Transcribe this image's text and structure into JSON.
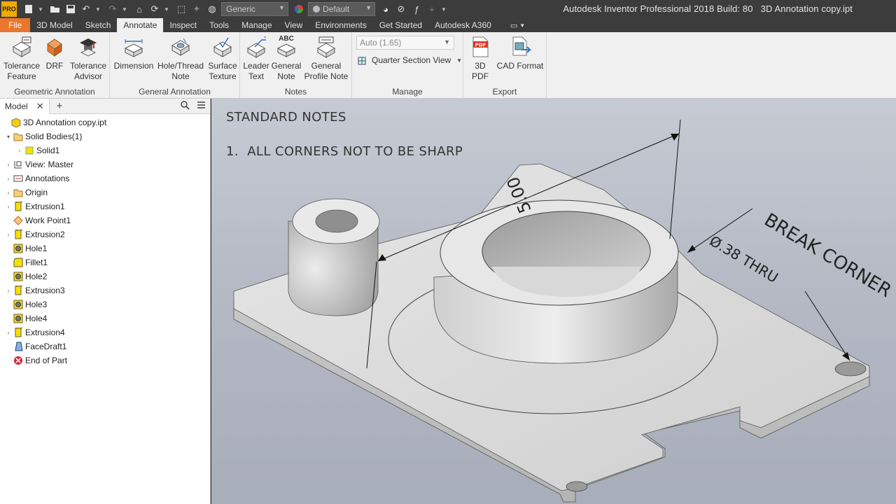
{
  "app": {
    "title": "Autodesk Inventor Professional 2018 Build: 80   3D Annotation copy.ipt",
    "logo_text": "PRO"
  },
  "quick_access": {
    "material_combo": "Generic",
    "appearance_combo": "Default",
    "icons": [
      "new-icon",
      "open-icon",
      "save-icon",
      "undo-icon",
      "redo-icon",
      "home-icon",
      "update-icon",
      "select-icon",
      "color-icon",
      "fx-icon",
      "plus-icon"
    ]
  },
  "tabs": [
    "File",
    "3D Model",
    "Sketch",
    "Annotate",
    "Inspect",
    "Tools",
    "Manage",
    "View",
    "Environments",
    "Get Started",
    "Autodesk A360"
  ],
  "active_tab": "Annotate",
  "ribbon": {
    "groups": {
      "geometric": "Geometric Annotation",
      "general": "General Annotation",
      "notes": "Notes",
      "manage": "Manage",
      "export": "Export"
    },
    "buttons": {
      "tolerance_feature": "Tolerance\nFeature",
      "drf": "DRF",
      "tolerance_advisor": "Tolerance\nAdvisor",
      "dimension": "Dimension",
      "hole_thread_note": "Hole/Thread\nNote",
      "surface_texture": "Surface\nTexture",
      "leader_text": "Leader\nText",
      "general_note": "General\nNote",
      "general_profile_note": "General\nProfile Note",
      "pdf_3d": "3D PDF",
      "cad_format": "CAD Format"
    },
    "manage": {
      "scale_combo": "Auto (1.65)",
      "section_view": "Quarter Section View"
    },
    "icon_labels": {
      "general_note_abc": "ABC"
    }
  },
  "browser": {
    "tab_label": "Model",
    "nodes": [
      {
        "label": "3D Annotation copy.ipt",
        "indent": 0,
        "expander": "",
        "icon": "part-icon"
      },
      {
        "label": "Solid Bodies(1)",
        "indent": 1,
        "expander": "▾",
        "icon": "folder-icon"
      },
      {
        "label": "Solid1",
        "indent": 2,
        "expander": "›",
        "icon": "solid-icon"
      },
      {
        "label": "View: Master",
        "indent": 1,
        "expander": "›",
        "icon": "view-icon"
      },
      {
        "label": "Annotations",
        "indent": 1,
        "expander": "›",
        "icon": "annotations-icon"
      },
      {
        "label": "Origin",
        "indent": 1,
        "expander": "›",
        "icon": "folder-icon"
      },
      {
        "label": "Extrusion1",
        "indent": 1,
        "expander": "›",
        "icon": "extrusion-icon"
      },
      {
        "label": "Work Point1",
        "indent": 1,
        "expander": "",
        "icon": "workpoint-icon"
      },
      {
        "label": "Extrusion2",
        "indent": 1,
        "expander": "›",
        "icon": "extrusion-icon"
      },
      {
        "label": "Hole1",
        "indent": 1,
        "expander": "",
        "icon": "hole-icon"
      },
      {
        "label": "Fillet1",
        "indent": 1,
        "expander": "",
        "icon": "fillet-icon"
      },
      {
        "label": "Hole2",
        "indent": 1,
        "expander": "",
        "icon": "hole-icon"
      },
      {
        "label": "Extrusion3",
        "indent": 1,
        "expander": "›",
        "icon": "extrusion-icon"
      },
      {
        "label": "Hole3",
        "indent": 1,
        "expander": "",
        "icon": "hole-icon"
      },
      {
        "label": "Hole4",
        "indent": 1,
        "expander": "",
        "icon": "hole-icon"
      },
      {
        "label": "Extrusion4",
        "indent": 1,
        "expander": "›",
        "icon": "extrusion-icon"
      },
      {
        "label": "FaceDraft1",
        "indent": 1,
        "expander": "",
        "icon": "facedraft-icon"
      },
      {
        "label": "End of Part",
        "indent": 1,
        "expander": "",
        "icon": "end-of-part-icon"
      }
    ]
  },
  "viewport": {
    "notes_title": "STANDARD NOTES",
    "note_1": "1.  ALL CORNERS NOT TO BE SHARP",
    "dimension_value": "5.00",
    "hole_note": "Ø.38 THRU",
    "leader_note": "BREAK CORNER"
  }
}
